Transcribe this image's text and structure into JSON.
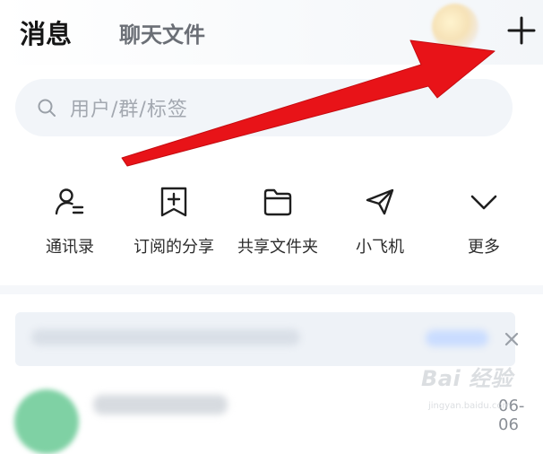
{
  "header": {
    "tabs": [
      {
        "label": "消息",
        "active": true
      },
      {
        "label": "聊天文件",
        "active": false
      }
    ],
    "add_icon": "plus-icon"
  },
  "search": {
    "placeholder": "用户/群/标签",
    "icon": "search-icon"
  },
  "quick_actions": [
    {
      "label": "通讯录",
      "icon": "contacts-icon"
    },
    {
      "label": "订阅的分享",
      "icon": "subscription-icon"
    },
    {
      "label": "共享文件夹",
      "icon": "folder-icon"
    },
    {
      "label": "小飞机",
      "icon": "paper-plane-icon"
    },
    {
      "label": "更多",
      "icon": "chevron-down-icon"
    }
  ],
  "chat_preview": {
    "time": "06-06"
  },
  "watermark": {
    "text": "Bai 经验",
    "sub": "jingyan.baidu.com"
  },
  "colors": {
    "arrow": "#e81318",
    "search_bg": "#f2f5f9",
    "text_primary": "#151515",
    "text_secondary": "#6b6f76"
  }
}
